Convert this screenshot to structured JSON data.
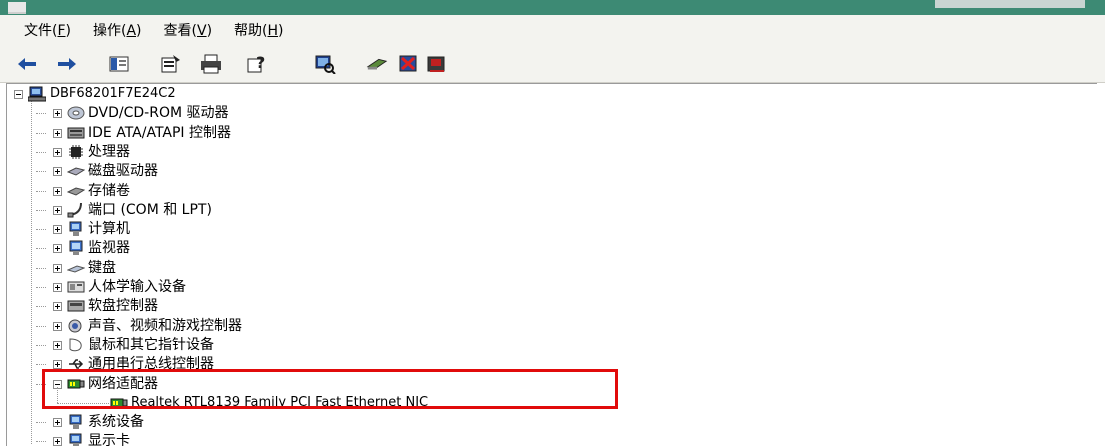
{
  "menu": {
    "items": [
      {
        "label": "文件(",
        "acc": "F",
        "suffix": ")"
      },
      {
        "label": "操作(",
        "acc": "A",
        "suffix": ")"
      },
      {
        "label": "查看(",
        "acc": "V",
        "suffix": ")"
      },
      {
        "label": "帮助(",
        "acc": "H",
        "suffix": ")"
      }
    ]
  },
  "toolbar": {
    "icons": [
      "back-arrow-icon",
      "forward-arrow-icon",
      "console-tree-icon",
      "properties-icon",
      "print-icon",
      "help-icon",
      "scan-hardware-icon",
      "update-driver-icon",
      "disable-device-icon",
      "uninstall-device-icon"
    ]
  },
  "tree": {
    "root": "DBF68201F7E24C2",
    "items": [
      {
        "label": "DVD/CD-ROM 驱动器",
        "icon": "cdrom-icon"
      },
      {
        "label": "IDE ATA/ATAPI 控制器",
        "icon": "ide-controller-icon"
      },
      {
        "label": "处理器",
        "icon": "processor-icon"
      },
      {
        "label": "磁盘驱动器",
        "icon": "disk-drive-icon"
      },
      {
        "label": "存储卷",
        "icon": "storage-volume-icon"
      },
      {
        "label": "端口 (COM 和 LPT)",
        "icon": "port-icon"
      },
      {
        "label": "计算机",
        "icon": "computer-icon"
      },
      {
        "label": "监视器",
        "icon": "monitor-icon"
      },
      {
        "label": "键盘",
        "icon": "keyboard-icon"
      },
      {
        "label": "人体学输入设备",
        "icon": "hid-icon"
      },
      {
        "label": "软盘控制器",
        "icon": "floppy-controller-icon"
      },
      {
        "label": "声音、视频和游戏控制器",
        "icon": "sound-icon"
      },
      {
        "label": "鼠标和其它指针设备",
        "icon": "mouse-icon"
      },
      {
        "label": "通用串行总线控制器",
        "icon": "usb-icon"
      },
      {
        "label": "网络适配器",
        "icon": "network-adapter-icon",
        "expanded": true,
        "children": [
          {
            "label": "Realtek RTL8139 Family PCI Fast Ethernet NIC",
            "icon": "network-card-icon"
          }
        ]
      },
      {
        "label": "系统设备",
        "icon": "system-device-icon"
      },
      {
        "label": "显示卡",
        "icon": "display-adapter-icon"
      }
    ]
  },
  "colors": {
    "highlight": "#e10b0b",
    "titlebar": "#3d8a74"
  }
}
